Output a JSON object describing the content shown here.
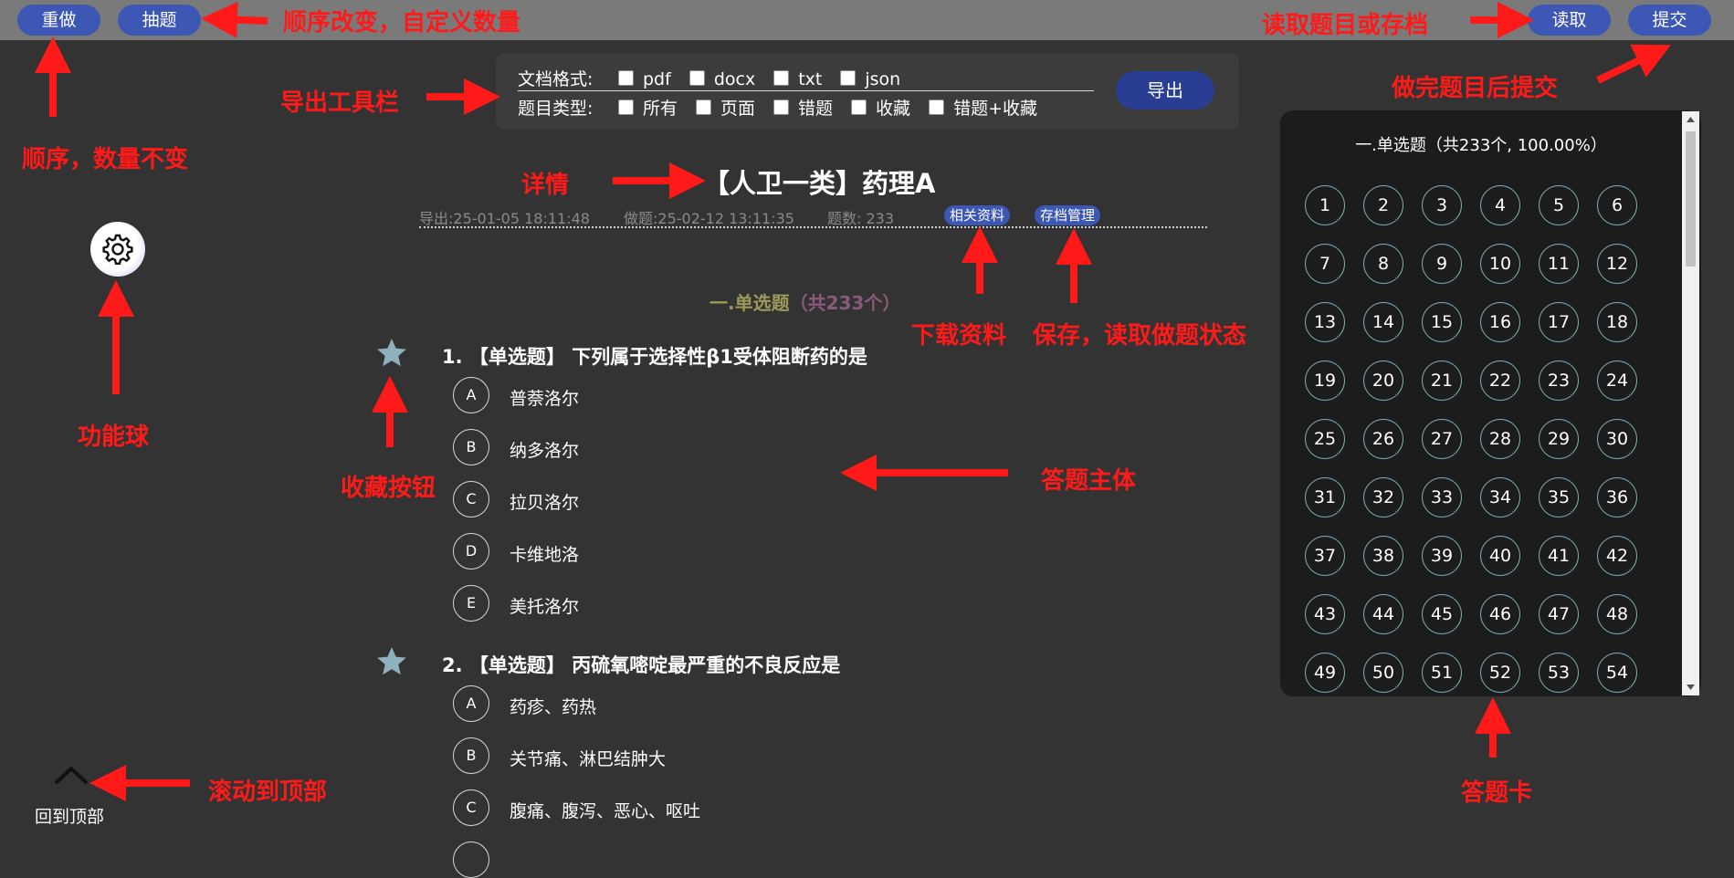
{
  "toolbar": {
    "redo_label": "重做",
    "draw_label": "抽题",
    "read_label": "读取",
    "submit_label": "提交"
  },
  "export_toolbar": {
    "format_label": "文档格式:",
    "formats": [
      "pdf",
      "docx",
      "txt",
      "json"
    ],
    "type_label": "题目类型:",
    "types": [
      "所有",
      "页面",
      "错题",
      "收藏",
      "错题+收藏"
    ],
    "export_button": "导出"
  },
  "detail": {
    "title": "【人卫一类】药理A",
    "export_time": "导出:25-01-05 18:11:48",
    "done_time": "做题:25-02-12 13:11:35",
    "count": "题数: 233",
    "tag_resources": "相关资料",
    "tag_archive": "存档管理"
  },
  "section": {
    "title": "一.单选题",
    "count": "（共233个）"
  },
  "questions": [
    {
      "title": "1. 【单选题】 下列属于选择性β1受体阻断药的是",
      "options": [
        {
          "letter": "A",
          "text": "普萘洛尔"
        },
        {
          "letter": "B",
          "text": "纳多洛尔"
        },
        {
          "letter": "C",
          "text": "拉贝洛尔"
        },
        {
          "letter": "D",
          "text": "卡维地洛"
        },
        {
          "letter": "E",
          "text": "美托洛尔"
        }
      ]
    },
    {
      "title": "2. 【单选题】 丙硫氧嘧啶最严重的不良反应是",
      "options": [
        {
          "letter": "A",
          "text": "药疹、药热"
        },
        {
          "letter": "B",
          "text": "关节痛、淋巴结肿大"
        },
        {
          "letter": "C",
          "text": "腹痛、腹泻、恶心、呕吐"
        }
      ]
    }
  ],
  "answer_card": {
    "title": "一.单选题（共233个, 100.00%）",
    "numbers": [
      "1",
      "2",
      "3",
      "4",
      "5",
      "6",
      "7",
      "8",
      "9",
      "10",
      "11",
      "12",
      "13",
      "14",
      "15",
      "16",
      "17",
      "18",
      "19",
      "20",
      "21",
      "22",
      "23",
      "24",
      "25",
      "26",
      "27",
      "28",
      "29",
      "30",
      "31",
      "32",
      "33",
      "34",
      "35",
      "36",
      "37",
      "38",
      "39",
      "40",
      "41",
      "42",
      "43",
      "44",
      "45",
      "46",
      "47",
      "48",
      "49",
      "50",
      "51",
      "52",
      "53",
      "54"
    ]
  },
  "back_to_top": "回到顶部",
  "annotations": {
    "order_change": "顺序改变，自定义数量",
    "order_same": "顺序，数量不变",
    "read_hint": "读取题目或存档",
    "submit_hint": "做完题目后提交",
    "export_toolbar": "导出工具栏",
    "detail": "详情",
    "function_ball": "功能球",
    "download": "下载资料",
    "save_state": "保存，读取做题状态",
    "favorite": "收藏按钮",
    "main": "答题主体",
    "scroll_top": "滚动到顶部",
    "answer_card": "答题卡"
  },
  "colors": {
    "background": "#333333",
    "topbar": "#7a7a7a",
    "button": "#3d57b5",
    "annotation": "#ff1a1a",
    "star": "#8fb0bd",
    "card_number_ring": "#7fb2c4"
  }
}
